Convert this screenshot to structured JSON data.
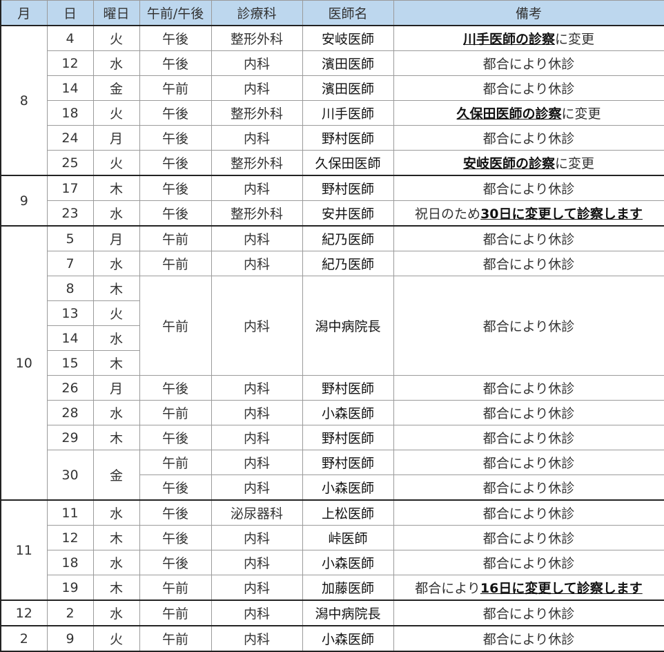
{
  "header": {
    "month": "月",
    "day": "日",
    "weekday": "曜日",
    "ampm": "午前/午後",
    "department": "診療科",
    "doctor": "医師名",
    "note": "備考"
  },
  "rows": {
    "r0": {
      "month": "8",
      "day": "4",
      "weekday": "火",
      "ampm": "午後",
      "department": "整形外科",
      "doctor": "安岐医師",
      "note_bold": "川手医師の診察",
      "note_suffix": "に変更"
    },
    "r1": {
      "day": "12",
      "weekday": "水",
      "ampm": "午後",
      "department": "内科",
      "doctor": "濱田医師",
      "note": "都合により休診"
    },
    "r2": {
      "day": "14",
      "weekday": "金",
      "ampm": "午前",
      "department": "内科",
      "doctor": "濱田医師",
      "note": "都合により休診"
    },
    "r3": {
      "day": "18",
      "weekday": "火",
      "ampm": "午後",
      "department": "整形外科",
      "doctor": "川手医師",
      "note_bold": "久保田医師の診察",
      "note_suffix": "に変更"
    },
    "r4": {
      "day": "24",
      "weekday": "月",
      "ampm": "午後",
      "department": "内科",
      "doctor": "野村医師",
      "note": "都合により休診"
    },
    "r5": {
      "day": "25",
      "weekday": "火",
      "ampm": "午後",
      "department": "整形外科",
      "doctor": "久保田医師",
      "note_bold": "安岐医師の診察",
      "note_suffix": "に変更"
    },
    "r6": {
      "month": "9",
      "day": "17",
      "weekday": "木",
      "ampm": "午後",
      "department": "内科",
      "doctor": "野村医師",
      "note": "都合により休診"
    },
    "r7": {
      "day": "23",
      "weekday": "水",
      "ampm": "午後",
      "department": "整形外科",
      "doctor": "安井医師",
      "note_prefix": "祝日のため",
      "note_bold": "30日に変更して診察します"
    },
    "r8": {
      "month": "10",
      "day": "5",
      "weekday": "月",
      "ampm": "午前",
      "department": "内科",
      "doctor": "紀乃医師",
      "note": "都合により休診"
    },
    "r9": {
      "day": "7",
      "weekday": "水",
      "ampm": "午前",
      "department": "内科",
      "doctor": "紀乃医師",
      "note": "都合により休診"
    },
    "r10": {
      "day": "8",
      "weekday": "木",
      "ampm": "午前",
      "department": "内科",
      "doctor": "潟中病院長",
      "note": "都合により休診"
    },
    "r11": {
      "day": "13",
      "weekday": "火"
    },
    "r12": {
      "day": "14",
      "weekday": "水"
    },
    "r13": {
      "day": "15",
      "weekday": "木"
    },
    "r14": {
      "day": "26",
      "weekday": "月",
      "ampm": "午後",
      "department": "内科",
      "doctor": "野村医師",
      "note": "都合により休診"
    },
    "r15": {
      "day": "28",
      "weekday": "水",
      "ampm": "午前",
      "department": "内科",
      "doctor": "小森医師",
      "note": "都合により休診"
    },
    "r16": {
      "day": "29",
      "weekday": "木",
      "ampm": "午後",
      "department": "内科",
      "doctor": "野村医師",
      "note": "都合により休診"
    },
    "r17": {
      "day": "30",
      "weekday": "金",
      "ampm": "午前",
      "department": "内科",
      "doctor": "野村医師",
      "note": "都合により休診"
    },
    "r18": {
      "ampm": "午後",
      "department": "内科",
      "doctor": "小森医師",
      "note": "都合により休診"
    },
    "r19": {
      "month": "11",
      "day": "11",
      "weekday": "水",
      "ampm": "午後",
      "department": "泌尿器科",
      "doctor": "上松医師",
      "note": "都合により休診"
    },
    "r20": {
      "day": "12",
      "weekday": "木",
      "ampm": "午後",
      "department": "内科",
      "doctor": "峠医師",
      "note": "都合により休診"
    },
    "r21": {
      "day": "18",
      "weekday": "水",
      "ampm": "午後",
      "department": "内科",
      "doctor": "小森医師",
      "note": "都合により休診"
    },
    "r22": {
      "day": "19",
      "weekday": "木",
      "ampm": "午前",
      "department": "内科",
      "doctor": "加藤医師",
      "note_prefix": "都合により",
      "note_bold": "16日に変更して診察します"
    },
    "r23": {
      "month": "12",
      "day": "2",
      "weekday": "水",
      "ampm": "午前",
      "department": "内科",
      "doctor": "潟中病院長",
      "note": "都合により休診"
    },
    "r24": {
      "month": "2",
      "day": "9",
      "weekday": "火",
      "ampm": "午前",
      "department": "内科",
      "doctor": "小森医師",
      "note": "都合により休診"
    }
  }
}
